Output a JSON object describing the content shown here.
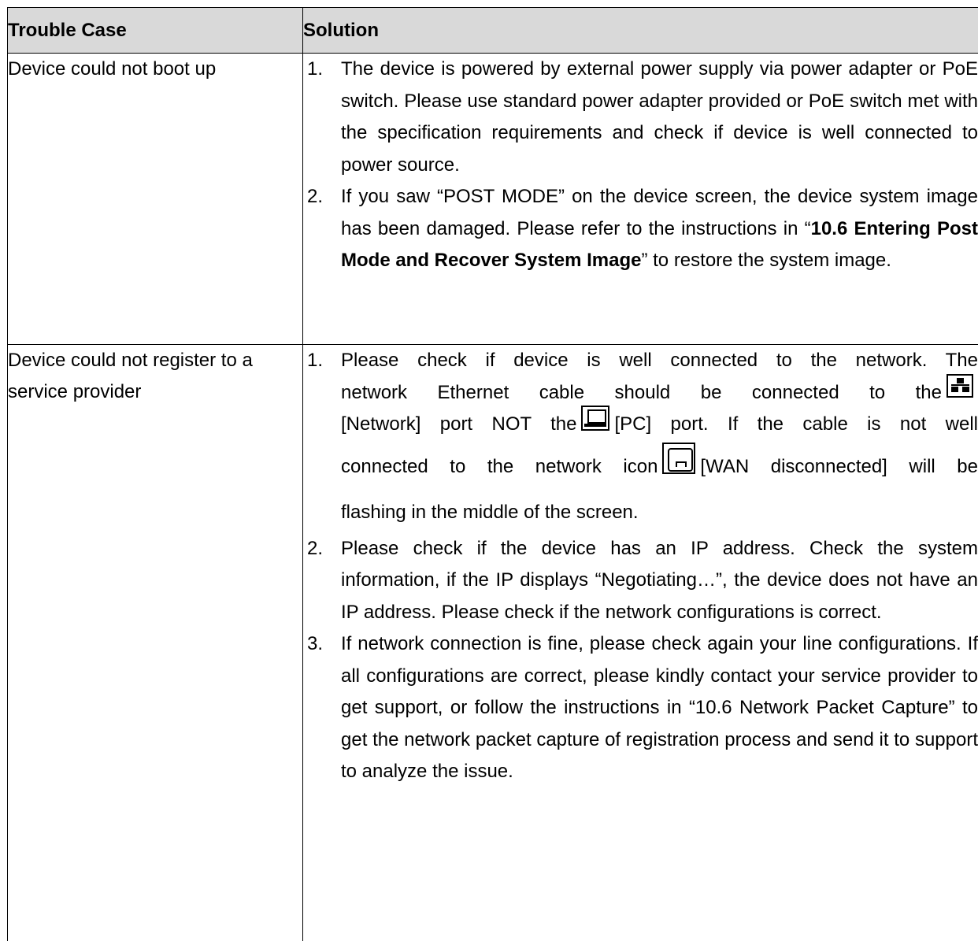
{
  "table": {
    "headers": {
      "case": "Trouble Case",
      "solution": "Solution"
    },
    "rows": [
      {
        "case": "Device could not boot up",
        "steps": [
          {
            "num": "1.",
            "text": "The device is powered by external power supply via power adapter or PoE switch. Please use standard power adapter provided or PoE switch met with the specification requirements and check if device is well connected to power source."
          },
          {
            "num": "2.",
            "pre": "If you saw “POST MODE” on the device screen, the device system image has been damaged. Please refer to the instructions in “",
            "bold": "10.6 Entering Post Mode and Recover System Image",
            "post": "” to restore the system image."
          }
        ]
      },
      {
        "case": "Device could not register to a service provider",
        "steps": [
          {
            "num": "1.",
            "a": "Please check if device is well connected to the network. The network Ethernet cable should be connected to the",
            "b": "[Network] port NOT the",
            "c": "[PC] port. If the cable is not well connected to the network icon",
            "d": "[WAN disconnected] will be flashing in the middle of the screen."
          },
          {
            "num": "2.",
            "text": "Please check if the device has an IP address. Check the system information, if the IP displays “Negotiating…”, the device does not have an IP address. Please check if the network configurations is correct."
          },
          {
            "num": "3.",
            "text": "If network connection is fine, please check again your line configurations. If all configurations are correct, please kindly contact your service provider to get support, or follow the instructions in “10.6 Network Packet Capture” to get the network packet capture of registration process and send it to support to analyze the issue."
          }
        ]
      }
    ]
  },
  "icons": {
    "network_port": "network-port-icon",
    "pc_port": "pc-port-icon",
    "wan_disconnected": "wan-disconnected-icon"
  }
}
